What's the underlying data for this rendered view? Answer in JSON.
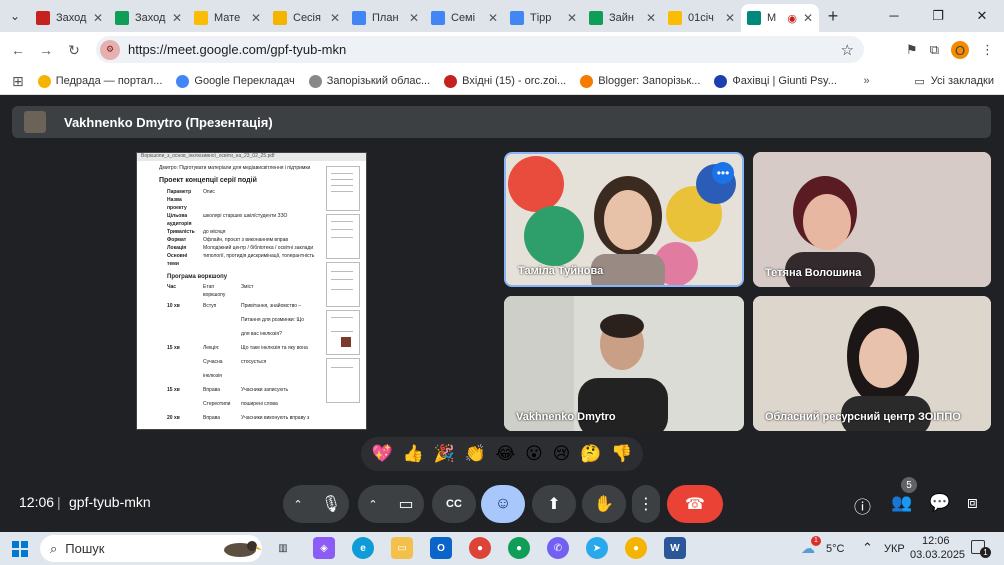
{
  "browser": {
    "tabs": [
      {
        "label": "Заход",
        "icon": "gmail-icon",
        "color": "#c5221f"
      },
      {
        "label": "Заход",
        "icon": "sheets-icon",
        "color": "#0f9d58"
      },
      {
        "label": "Мате",
        "icon": "drive-icon",
        "color": "#fbbc04"
      },
      {
        "label": "Сесія",
        "icon": "slides-icon",
        "color": "#f4b400"
      },
      {
        "label": "План",
        "icon": "docs-icon",
        "color": "#4285f4"
      },
      {
        "label": "Семі",
        "icon": "docs-icon",
        "color": "#4285f4"
      },
      {
        "label": "Тіpp",
        "icon": "docs-icon",
        "color": "#4285f4"
      },
      {
        "label": "Зайн",
        "icon": "sheets-icon",
        "color": "#0f9d58"
      },
      {
        "label": "01січ",
        "icon": "drive-icon",
        "color": "#fbbc04"
      },
      {
        "label": "M",
        "icon": "meet-icon",
        "color": "#00897b"
      }
    ],
    "url": "https://meet.google.com/gpf-tyub-mkn",
    "profile_letter": "О",
    "bookmarks": [
      {
        "label": "Педрада — портал...",
        "color": "#f4b400"
      },
      {
        "label": "Google Перекладач",
        "color": "#4285f4"
      },
      {
        "label": "Запорізький облас...",
        "color": "#888888"
      },
      {
        "label": "Вхідні (15) - orc.zoi...",
        "color": "#c5221f"
      },
      {
        "label": "Blogger: Запорізьк...",
        "color": "#f57c00"
      },
      {
        "label": "Фахівці | Giunti Psy...",
        "color": "#1e40af"
      }
    ],
    "all_bookmarks": "Усі закладки"
  },
  "meet": {
    "presenter_label": "Vakhnenko Dmytro (Презентація)",
    "presentation": {
      "file_title": "Воркшопи_з_основ_інклюзивної_освіти_на_23_02_25.pdf",
      "note": "Дмитро: Підготувати матеріали для медіависвітлення і підтримки",
      "heading1": "Проект концепції серії подій",
      "rows": [
        [
          "Параметр",
          "Опис"
        ],
        [
          "Назва проекту",
          ""
        ],
        [
          "Цільова аудиторія",
          "школярі старших шкіл/студенти ЗЗО"
        ],
        [
          "Тривалість",
          "до місяця"
        ],
        [
          "Формат",
          "Офлайн, проєкт з виконанням вправ"
        ],
        [
          "Локація",
          "Молодіжний центр / бібліотека / освітні заклади"
        ],
        [
          "Основні теми",
          "типології, протидія дискримінації, толерантність"
        ]
      ],
      "heading2": "Програма воркшопу",
      "prog_rows": [
        [
          "Час",
          "Етап воркшопу",
          "Зміст"
        ],
        [
          "10 хв",
          "Вступ",
          "Привітання, знайомство – Питання для розминки: Що для вас інклюзія?"
        ],
        [
          "15 хв",
          "Лекція: Сучасна інклюзія",
          "Що таке інклюзія та яку вона стосується"
        ],
        [
          "15 хв",
          "Вправа Стереотипи",
          "Учасники записують поширені слова"
        ],
        [
          "20 хв",
          "Вправа Привілеї",
          "Учасники виконують вправу з кроками"
        ],
        [
          "10 хв",
          "Підсумки та рефлексія",
          "Метод Одного слова"
        ]
      ]
    },
    "participants": [
      {
        "name": "Таміла Туйнова",
        "active": true
      },
      {
        "name": "Тетяна Волошина",
        "active": false
      },
      {
        "name": "Vakhnenko Dmytro",
        "active": false
      },
      {
        "name": "Обласний ресурсний центр ЗОІППО",
        "active": false
      }
    ],
    "reactions": [
      "💖",
      "👍",
      "🎉",
      "👏",
      "😂",
      "😮",
      "😢",
      "🤔",
      "👎"
    ],
    "time": "12:06",
    "separator": "|",
    "meeting_code": "gpf-tyub-mkn",
    "participants_count": "5"
  },
  "taskbar": {
    "search_placeholder": "Пошук",
    "weather": "5°C",
    "weather_badge": "1",
    "lang": "УКР",
    "time": "12:06",
    "date": "03.03.2025",
    "notifications": "1"
  }
}
